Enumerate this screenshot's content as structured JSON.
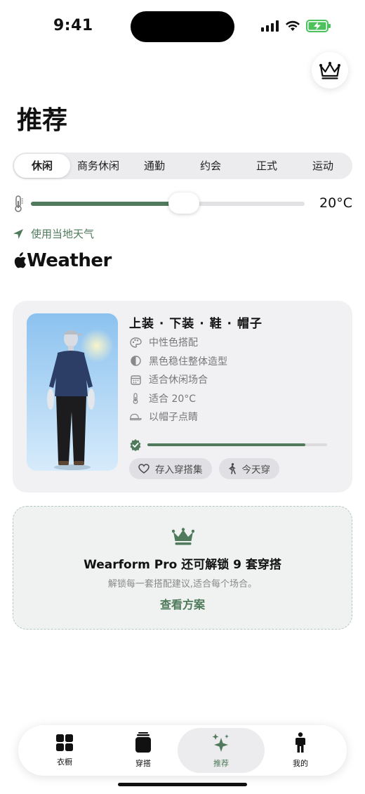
{
  "status_bar": {
    "time": "9:41"
  },
  "header": {
    "title": "推荐",
    "pro_icon": "crown-icon"
  },
  "occasions": {
    "items": [
      "休闲",
      "商务休闲",
      "通勤",
      "约会",
      "正式",
      "运动"
    ],
    "selected_index": 0
  },
  "temperature": {
    "value": 20,
    "display": "20°C",
    "slider_fraction": 0.56
  },
  "weather": {
    "use_local_label": "使用当地天气",
    "brand_label": "Weather"
  },
  "outfit": {
    "title": "上装 · 下装 · 鞋 · 帽子",
    "attributes": [
      {
        "icon": "palette-icon",
        "text": "中性色搭配"
      },
      {
        "icon": "contrast-icon",
        "text": "黑色稳住整体造型"
      },
      {
        "icon": "calendar-icon",
        "text": "适合休闲场合"
      },
      {
        "icon": "thermometer-icon",
        "text": "适合 20°C"
      },
      {
        "icon": "cap-icon",
        "text": "以帽子点睛"
      }
    ],
    "match_score": 0.88,
    "save_label": "存入穿搭集",
    "wear_label": "今天穿"
  },
  "pro_promo": {
    "title": "Wearform Pro 还可解锁 9 套穿搭",
    "subtitle": "解锁每一套搭配建议,适合每个场合。",
    "link_label": "查看方案"
  },
  "tab_bar": {
    "items": [
      {
        "label": "衣橱",
        "icon": "grid-icon"
      },
      {
        "label": "穿搭",
        "icon": "outfit-stack-icon"
      },
      {
        "label": "推荐",
        "icon": "sparkles-icon"
      },
      {
        "label": "我的",
        "icon": "person-icon"
      }
    ],
    "active_index": 2
  },
  "colors": {
    "accent": "#4f7a5b",
    "card_bg": "#f1f1f4",
    "promo_bg": "#eff2f0"
  }
}
